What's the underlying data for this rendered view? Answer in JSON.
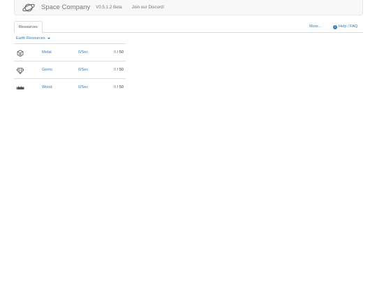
{
  "navbar": {
    "brand": "Space Company",
    "version": "V0.5.1.2 Beta",
    "discord": "Join our Discord!"
  },
  "tabs": {
    "resources": "Resources",
    "more": "More...",
    "help": "Help / FAQ",
    "help_icon": "i"
  },
  "category": {
    "label": "Earth Resources"
  },
  "resources": [
    {
      "name": "Metal",
      "rate": "0/Sec",
      "current": "0",
      "sep": " / ",
      "max": "50",
      "icon": "metal-icon"
    },
    {
      "name": "Gems",
      "rate": "0/Sec",
      "current": "0",
      "sep": " / ",
      "max": "50",
      "icon": "gem-icon"
    },
    {
      "name": "Wood",
      "rate": "0/Sec",
      "current": "0",
      "sep": " / ",
      "max": "50",
      "icon": "wood-icon"
    }
  ],
  "colors": {
    "link": "#337ab7",
    "danger": "#d9534f",
    "navbar_bg": "#f8f8f8",
    "border": "#dddddd"
  }
}
